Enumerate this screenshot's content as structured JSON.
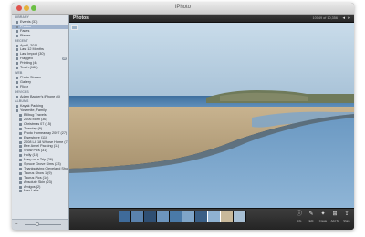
{
  "window": {
    "title": "iPhoto"
  },
  "sidebar": {
    "sections": [
      {
        "label": "LIBRARY",
        "items": [
          {
            "label": "Events (37)",
            "icon": "events-icon"
          },
          {
            "label": "Photos",
            "icon": "photos-icon",
            "selected": true
          },
          {
            "label": "Faces",
            "icon": "faces-icon"
          },
          {
            "label": "Places",
            "icon": "places-icon"
          }
        ]
      },
      {
        "label": "RECENT",
        "items": [
          {
            "label": "Apr 6, 2011",
            "icon": "event-icon"
          },
          {
            "label": "Last 12 Months",
            "icon": "calendar-icon"
          },
          {
            "label": "Last Import (30)",
            "icon": "import-icon"
          },
          {
            "label": "Flagged",
            "icon": "flag-icon",
            "badge": "22"
          },
          {
            "label": "Printing (4)",
            "icon": "print-icon"
          },
          {
            "label": "Trash (186)",
            "icon": "trash-icon"
          }
        ]
      },
      {
        "label": "WEB",
        "items": [
          {
            "label": "Photo Stream",
            "icon": "photostream-icon"
          },
          {
            "label": "Gallery",
            "icon": "gallery-icon"
          },
          {
            "label": "Flickr",
            "icon": "flickr-icon"
          }
        ]
      },
      {
        "label": "DEVICES",
        "items": [
          {
            "label": "Adam Backer's iPhone (4)",
            "icon": "iphone-icon"
          }
        ]
      },
      {
        "label": "ALBUMS",
        "items": [
          {
            "label": "Kayak Packing",
            "icon": "folder-icon"
          },
          {
            "label": "Yosemite, Family",
            "icon": "folder-icon"
          },
          {
            "label": "Billbug Travels",
            "icon": "album-icon",
            "indent": true
          },
          {
            "label": "2006 Mom (36)",
            "icon": "album-icon",
            "indent": true
          },
          {
            "label": "Christmas 07 (15)",
            "icon": "album-icon",
            "indent": true
          },
          {
            "label": "Tuesday (9)",
            "icon": "album-icon",
            "indent": true
          },
          {
            "label": "Photo Homeaway 2007 (27)",
            "icon": "album-icon",
            "indent": true
          },
          {
            "label": "Elsewhere (11)",
            "icon": "album-icon",
            "indent": true
          },
          {
            "label": "2008 LA 18 Whose Home (74)",
            "icon": "album-icon",
            "indent": true
          },
          {
            "label": "Bee Ansel Packing (11)",
            "icon": "album-icon",
            "indent": true
          },
          {
            "label": "Snow Pics (31)",
            "icon": "album-icon",
            "indent": true
          },
          {
            "label": "Holly (10)",
            "icon": "album-icon",
            "indent": true
          },
          {
            "label": "Mary on a Trip (26)",
            "icon": "album-icon",
            "indent": true
          },
          {
            "label": "Spruce Grove Sims (23)",
            "icon": "album-icon",
            "indent": true
          },
          {
            "label": "Thanksgiving Cleveland Shows (56)",
            "icon": "album-icon",
            "indent": true
          },
          {
            "label": "Taurus Show 1 (9)",
            "icon": "album-icon",
            "indent": true
          },
          {
            "label": "Taurus Pics (14)",
            "icon": "album-icon",
            "indent": true
          },
          {
            "label": "Absolute Skin (23)",
            "icon": "album-icon",
            "indent": true
          },
          {
            "label": "Amigos (2)",
            "icon": "album-icon",
            "indent": true
          },
          {
            "label": "Mex Lake",
            "icon": "album-icon",
            "indent": true
          }
        ]
      }
    ]
  },
  "viewer": {
    "title": "Photos",
    "counter": "10049 of 10,356",
    "prev_icon": "previous-arrow-icon",
    "next_icon": "next-arrow-icon"
  },
  "toolbar": {
    "tools": [
      {
        "label": "Info",
        "icon": "info-icon",
        "glyph": "ⓘ"
      },
      {
        "label": "Edit",
        "icon": "edit-icon",
        "glyph": "✎"
      },
      {
        "label": "Create",
        "icon": "create-icon",
        "glyph": "✦"
      },
      {
        "label": "Add To",
        "icon": "add-to-icon",
        "glyph": "⊞"
      },
      {
        "label": "Share",
        "icon": "share-icon",
        "glyph": "⇪"
      }
    ]
  },
  "filmstrip": {
    "thumbs": [
      {
        "color": "#3f6b9a"
      },
      {
        "color": "#5a82ad"
      },
      {
        "color": "#2f4f73"
      },
      {
        "color": "#6d95bd"
      },
      {
        "color": "#4a7aa8"
      },
      {
        "color": "#7fa5c8"
      },
      {
        "color": "#3a5f86"
      },
      {
        "color": "#8fb2d2",
        "active": true
      },
      {
        "color": "#c8b89a"
      },
      {
        "color": "#a7bfd4"
      }
    ]
  },
  "colors": {
    "sky": "#bfd5e4",
    "water": "#4f7fad",
    "sand": "#b9a482",
    "accent_selection": "#9fb2cc"
  }
}
